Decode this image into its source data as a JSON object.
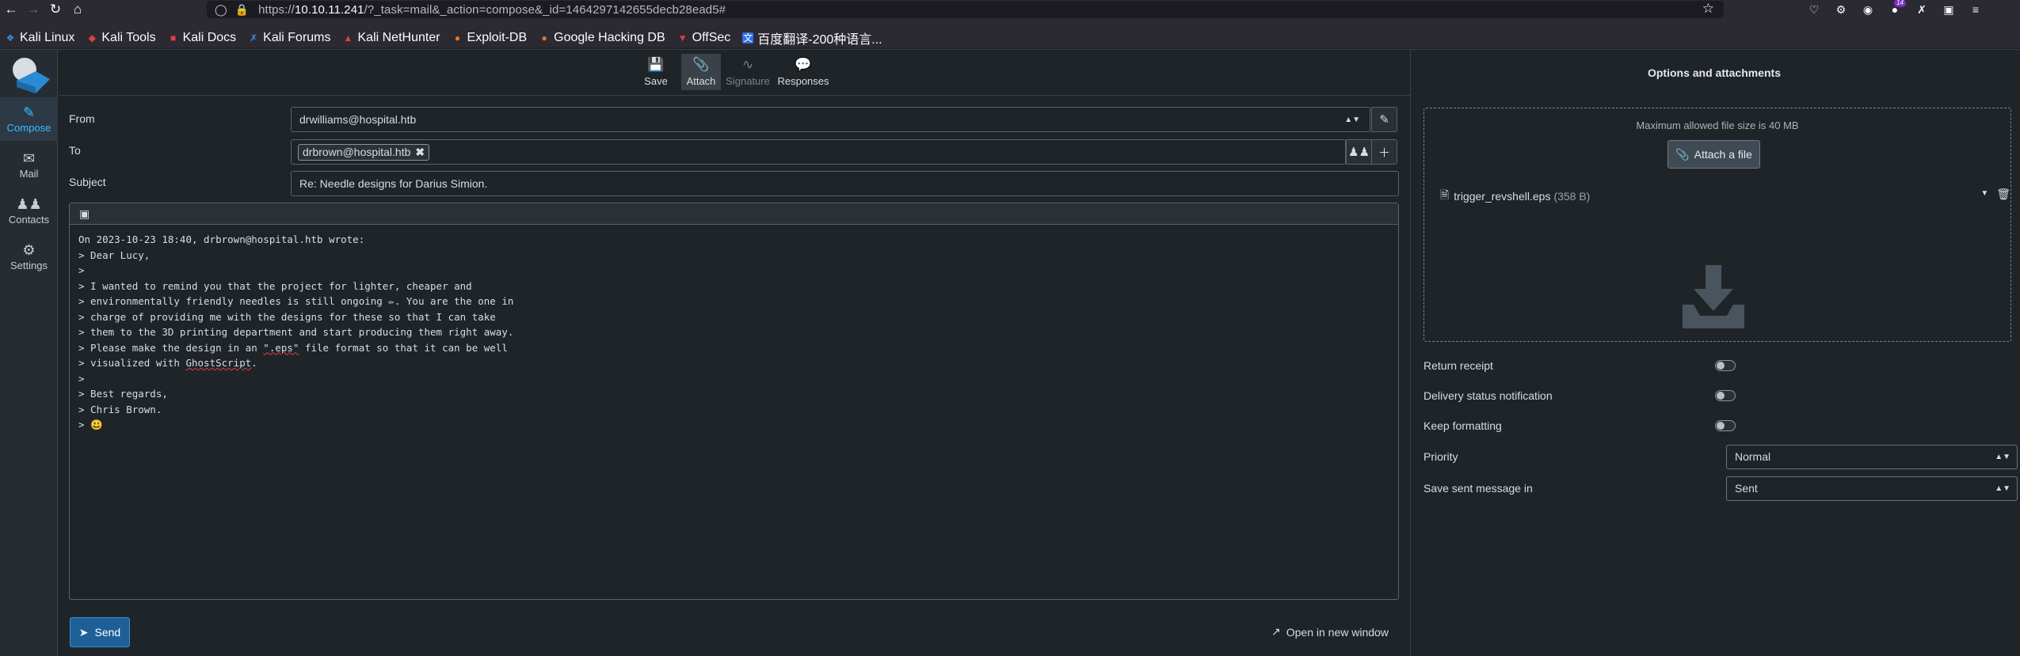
{
  "browser": {
    "url_prefix": "https://",
    "url_host": "10.10.11.241",
    "url_path": "/?_task=mail&_action=compose&_id=1464297142655decb28ead5#",
    "bookmarks": [
      "Kali Linux",
      "Kali Tools",
      "Kali Docs",
      "Kali Forums",
      "Kali NetHunter",
      "Exploit-DB",
      "Google Hacking DB",
      "OffSec",
      "百度翻译-200种语言..."
    ],
    "badge_count": "14"
  },
  "sidebar": {
    "items": [
      {
        "label": "Compose",
        "icon": "pencil-square-icon",
        "active": true
      },
      {
        "label": "Mail",
        "icon": "envelope-icon",
        "active": false
      },
      {
        "label": "Contacts",
        "icon": "users-icon",
        "active": false
      },
      {
        "label": "Settings",
        "icon": "gear-icon",
        "active": false
      }
    ]
  },
  "toolbar": {
    "save": "Save",
    "attach": "Attach",
    "signature": "Signature",
    "responses": "Responses"
  },
  "compose": {
    "from_label": "From",
    "from_value": "drwilliams@hospital.htb",
    "to_label": "To",
    "to_recipient": "drbrown@hospital.htb",
    "subject_label": "Subject",
    "subject_value": "Re: Needle designs for Darius Simion.",
    "body_lines": [
      "On 2023-10-23 18:40, drbrown@hospital.htb wrote:",
      "> Dear Lucy,",
      ">",
      "> I wanted to remind you that the project for lighter, cheaper and",
      "> environmentally friendly needles is still ongoing ✏. You are the one in",
      "> charge of providing me with the designs for these so that I can take",
      "> them to the 3D printing department and start producing them right away.",
      "> Please make the design in an \".eps\" file format so that it can be well",
      "> visualized with GhostScript.",
      ">",
      "> Best regards,",
      "> Chris Brown.",
      "> 😃"
    ],
    "send_label": "Send",
    "open_new_window": "Open in new window"
  },
  "options": {
    "title": "Options and attachments",
    "max_size": "Maximum allowed file size is 40 MB",
    "attach_button": "Attach a file",
    "attachment_name": "trigger_revshell.eps",
    "attachment_size": "(358 B)",
    "return_receipt": "Return receipt",
    "delivery_status": "Delivery status notification",
    "keep_formatting": "Keep formatting",
    "priority_label": "Priority",
    "priority_value": "Normal",
    "save_sent_label": "Save sent message in",
    "save_sent_value": "Sent",
    "return_receipt_on": false,
    "delivery_status_on": false,
    "keep_formatting_on": false
  },
  "colors": {
    "accent": "#37beff",
    "send_button": "#1e5f97"
  }
}
